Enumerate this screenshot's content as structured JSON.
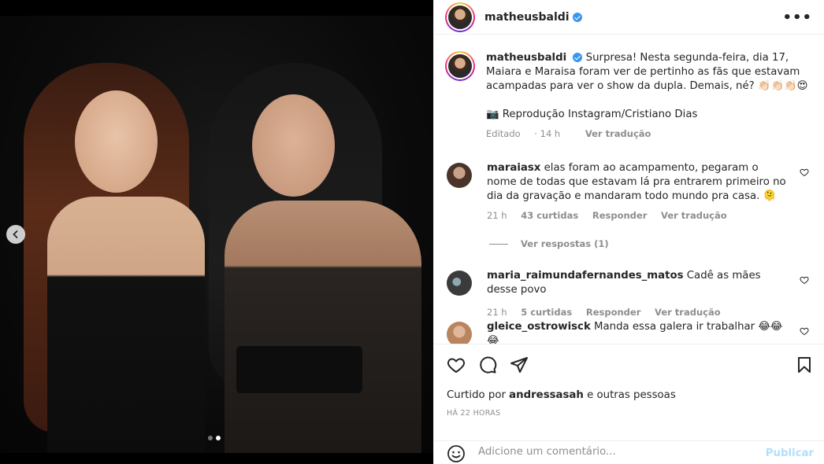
{
  "post": {
    "username": "matheusbaldi",
    "caption": {
      "text": "Surpresa! Nesta segunda-feira, dia 17, Maiara e Maraisa foram ver de pertinho as fãs que estavam acampadas para ver o show da dupla. Demais, né? 👏🏻👏🏻👏🏻😍",
      "credit": "📷 Reprodução Instagram/Cristiano Dias",
      "edited": "Editado",
      "time": "14 h",
      "translate": "Ver tradução"
    },
    "comments": [
      {
        "username": "maraiasx",
        "text": "elas foram ao acampamento, pegaram o nome de todas que estavam lá pra entrarem primeiro no dia da gravação e mandaram todo mundo pra casa. 🫠",
        "time": "21 h",
        "likes": "43 curtidas",
        "reply": "Responder",
        "translate": "Ver tradução",
        "view_replies": "Ver respostas (1)"
      },
      {
        "username": "maria_raimundafernandes_matos",
        "text": "Cadê as mães desse povo",
        "time": "21 h",
        "likes": "5 curtidas",
        "reply": "Responder",
        "translate": "Ver tradução"
      },
      {
        "username": "gleice_ostrowisck",
        "text": "Manda essa galera ir trabalhar 😂😂😂"
      }
    ],
    "likes_prefix": "Curtido por",
    "likes_user": "andressasah",
    "likes_suffix": "e outras pessoas",
    "time_ago": "HÁ 22 HORAS",
    "add_comment_placeholder": "Adicione um comentário...",
    "publish_label": "Publicar",
    "more_label": "•••"
  },
  "carousel": {
    "total": 2,
    "current": 2
  },
  "colors": {
    "verified": "#3897f0",
    "publish": "#b2dffc",
    "muted": "#8e8e8e"
  }
}
